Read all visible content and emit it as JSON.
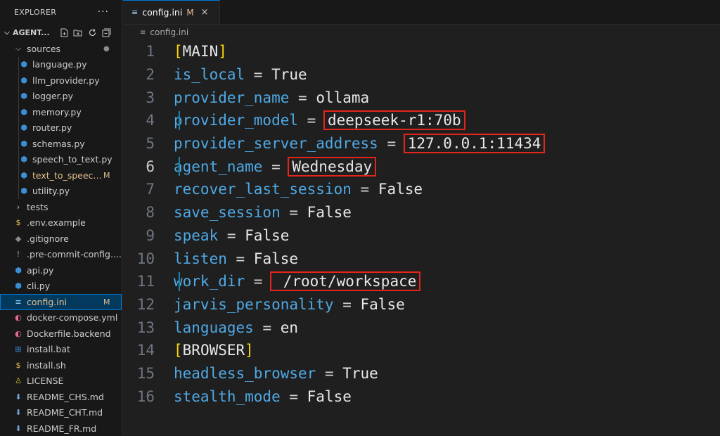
{
  "sidebar": {
    "header": "EXPLORER",
    "more": "···",
    "root": "AGENT...",
    "items": [
      {
        "label": "sources",
        "icon": "chevron-down-icon",
        "icon_char": "⌵",
        "kind": "folder",
        "indent": 1,
        "dot": "●"
      },
      {
        "label": "language.py",
        "icon": "python-icon",
        "icon_char": "⬢",
        "kind": "py",
        "indent": 2
      },
      {
        "label": "llm_provider.py",
        "icon": "python-icon",
        "icon_char": "⬢",
        "kind": "py",
        "indent": 2
      },
      {
        "label": "logger.py",
        "icon": "python-icon",
        "icon_char": "⬢",
        "kind": "py",
        "indent": 2
      },
      {
        "label": "memory.py",
        "icon": "python-icon",
        "icon_char": "⬢",
        "kind": "py",
        "indent": 2
      },
      {
        "label": "router.py",
        "icon": "python-icon",
        "icon_char": "⬢",
        "kind": "py",
        "indent": 2
      },
      {
        "label": "schemas.py",
        "icon": "python-icon",
        "icon_char": "⬢",
        "kind": "py",
        "indent": 2
      },
      {
        "label": "speech_to_text.py",
        "icon": "python-icon",
        "icon_char": "⬢",
        "kind": "py",
        "indent": 2
      },
      {
        "label": "text_to_speech.py",
        "icon": "python-icon",
        "icon_char": "⬢",
        "kind": "py",
        "indent": 2,
        "badge": "M"
      },
      {
        "label": "utility.py",
        "icon": "python-icon",
        "icon_char": "⬢",
        "kind": "py",
        "indent": 2
      },
      {
        "label": "tests",
        "icon": "chevron-right-icon",
        "icon_char": "›",
        "kind": "folder",
        "indent": 1
      },
      {
        "label": ".env.example",
        "icon": "dollar-icon",
        "icon_char": "$",
        "kind": "env",
        "indent": 1
      },
      {
        "label": ".gitignore",
        "icon": "git-icon",
        "icon_char": "◆",
        "kind": "git",
        "indent": 1
      },
      {
        "label": ".pre-commit-config....",
        "icon": "exclamation-icon",
        "icon_char": "!",
        "kind": "yaml",
        "indent": 1
      },
      {
        "label": "api.py",
        "icon": "python-icon",
        "icon_char": "⬢",
        "kind": "py",
        "indent": 1
      },
      {
        "label": "cli.py",
        "icon": "python-icon",
        "icon_char": "⬢",
        "kind": "py",
        "indent": 1
      },
      {
        "label": "config.ini",
        "icon": "settings-file-icon",
        "icon_char": "≡",
        "kind": "ini",
        "indent": 1,
        "badge": "M",
        "active": true
      },
      {
        "label": "docker-compose.yml",
        "icon": "docker-icon",
        "icon_char": "◐",
        "kind": "docker",
        "indent": 1
      },
      {
        "label": "Dockerfile.backend",
        "icon": "docker-icon",
        "icon_char": "◐",
        "kind": "docker",
        "indent": 1
      },
      {
        "label": "install.bat",
        "icon": "windows-icon",
        "icon_char": "⊞",
        "kind": "bat",
        "indent": 1
      },
      {
        "label": "install.sh",
        "icon": "dollar-icon",
        "icon_char": "$",
        "kind": "sh",
        "indent": 1
      },
      {
        "label": "LICENSE",
        "icon": "license-icon",
        "icon_char": "♙",
        "kind": "license",
        "indent": 1
      },
      {
        "label": "README_CHS.md",
        "icon": "markdown-icon",
        "icon_char": "⬇",
        "kind": "md",
        "indent": 1
      },
      {
        "label": "README_CHT.md",
        "icon": "markdown-icon",
        "icon_char": "⬇",
        "kind": "md",
        "indent": 1
      },
      {
        "label": "README_FR.md",
        "icon": "markdown-icon",
        "icon_char": "⬇",
        "kind": "md",
        "indent": 1
      }
    ]
  },
  "tab": {
    "label": "config.ini",
    "modified": "M",
    "close": "×",
    "icon_char": "≡"
  },
  "breadcrumb": {
    "label": "config.ini",
    "icon_char": "≡"
  },
  "colors": {
    "key": "#4fa9e5",
    "bracket": "#ffd700",
    "highlight_box": "#e3261b",
    "active_row": "#04395e",
    "modified": "#e2c08d"
  },
  "code": [
    {
      "n": "1",
      "section": "MAIN"
    },
    {
      "n": "2",
      "key": "is_local",
      "value": "True"
    },
    {
      "n": "3",
      "key": "provider_name",
      "value": "ollama"
    },
    {
      "n": "4",
      "key": "provider_model",
      "value": "deepseek-r1:70b",
      "highlight": true,
      "mark": true
    },
    {
      "n": "5",
      "key": "provider_server_address",
      "value": "127.0.0.1:11434",
      "highlight": true
    },
    {
      "n": "6",
      "key": "agent_name",
      "value": "Wednesday",
      "highlight": true,
      "current": true,
      "mark": true
    },
    {
      "n": "7",
      "key": "recover_last_session",
      "value": "False"
    },
    {
      "n": "8",
      "key": "save_session",
      "value": "False"
    },
    {
      "n": "9",
      "key": "speak",
      "value": "False"
    },
    {
      "n": "10",
      "key": "listen",
      "value": "False"
    },
    {
      "n": "11",
      "key": "work_dir",
      "value": " /root/workspace",
      "highlight": true,
      "mark": true
    },
    {
      "n": "12",
      "key": "jarvis_personality",
      "value": "False"
    },
    {
      "n": "13",
      "key": "languages",
      "value": "en"
    },
    {
      "n": "14",
      "section": "BROWSER"
    },
    {
      "n": "15",
      "key": "headless_browser",
      "value": "True"
    },
    {
      "n": "16",
      "key": "stealth_mode",
      "value": "False"
    }
  ]
}
